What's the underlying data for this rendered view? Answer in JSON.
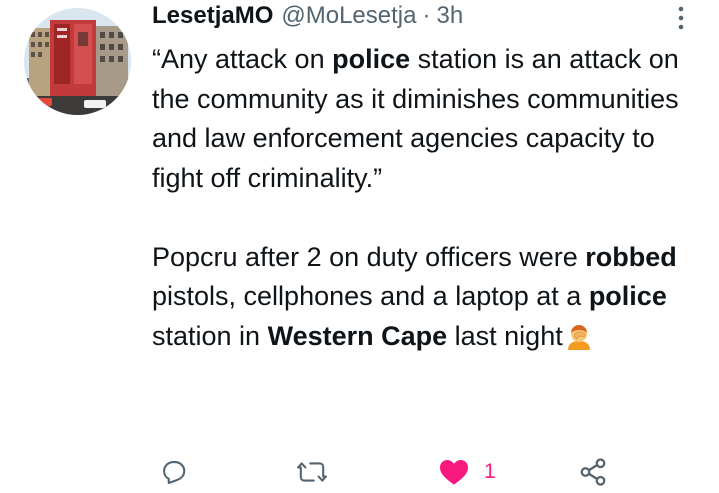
{
  "tweet": {
    "author_name": "LesetjaMO",
    "handle": "@MoLesetja",
    "separator": "·",
    "time": "3h",
    "paragraph1": [
      {
        "text": "“Any attack on ",
        "bold": false
      },
      {
        "text": "police",
        "bold": true
      },
      {
        "text": " station is an attack on the community as it diminishes communities and law enforcement agencies capacity to fight off criminality.”",
        "bold": false
      }
    ],
    "paragraph2": [
      {
        "text": "Popcru after 2 on duty officers were ",
        "bold": false
      },
      {
        "text": "robbed",
        "bold": true
      },
      {
        "text": " pistols, cellphones and a laptop at a ",
        "bold": false
      },
      {
        "text": "police",
        "bold": true
      },
      {
        "text": " station in ",
        "bold": false
      },
      {
        "text": "Western Cape",
        "bold": true
      },
      {
        "text": " last night",
        "bold": false
      }
    ],
    "emoji": "face-palm-emoji"
  },
  "actions": {
    "reply_icon": "reply-icon",
    "retweet_icon": "retweet-icon",
    "like_icon": "heart-filled-icon",
    "like_count": "1",
    "share_icon": "share-icon",
    "like_color": "#f91880",
    "icon_color": "#536471"
  }
}
